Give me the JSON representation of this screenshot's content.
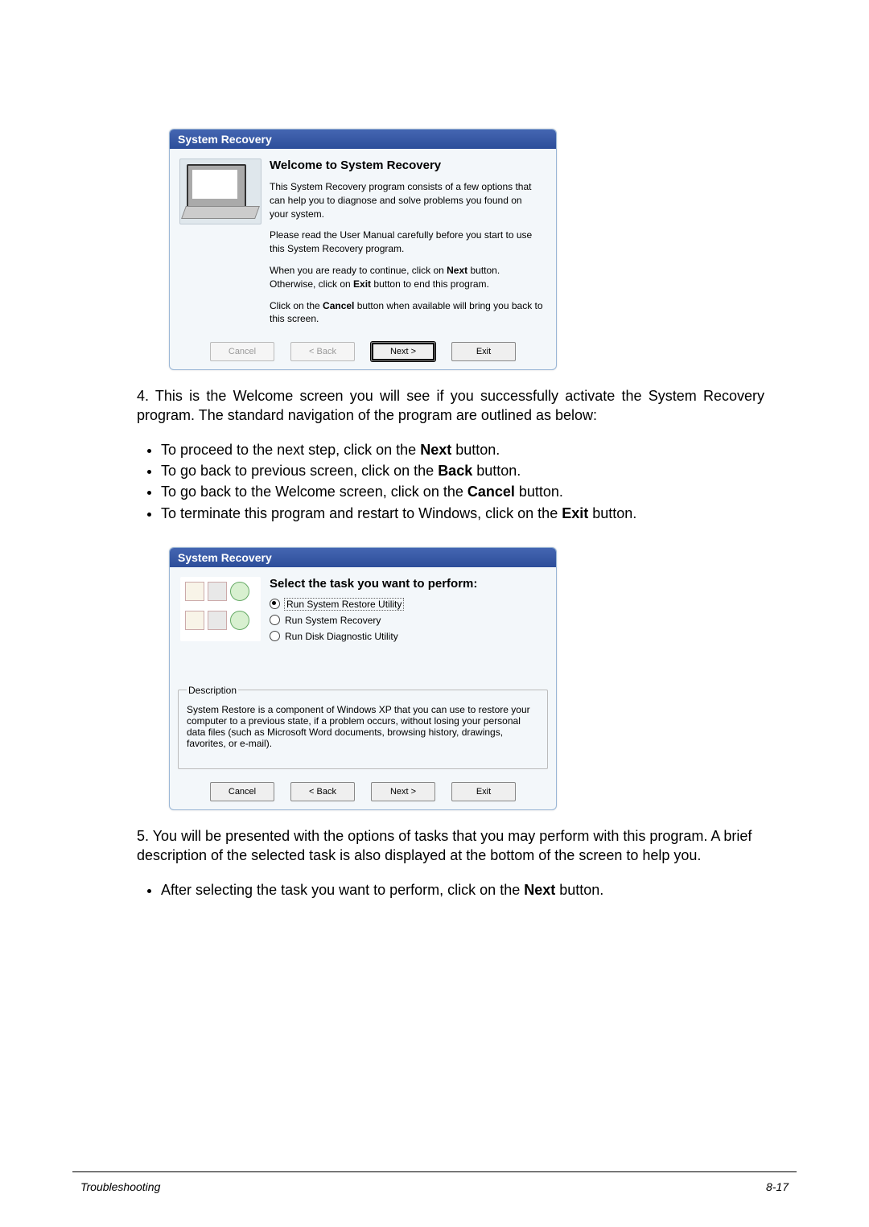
{
  "dialog1": {
    "title": "System Recovery",
    "heading": "Welcome to System Recovery",
    "p1": "This System Recovery program consists of a few options that can help you to diagnose and solve problems you found on your system.",
    "p2": "Please read the User Manual carefully before you start to use this System Recovery program.",
    "p3_a": "When you are ready to continue, click on ",
    "p3_b": "Next",
    "p3_c": " button. Otherwise, click on ",
    "p3_d": "Exit",
    "p3_e": " button to end this program.",
    "p4_a": "Click on the ",
    "p4_b": "Cancel",
    "p4_c": " button when available will bring you back to this screen.",
    "buttons": {
      "cancel": "Cancel",
      "back": "< Back",
      "next": "Next >",
      "exit": "Exit"
    }
  },
  "step4": {
    "lead": "4. This is the Welcome screen you will see if you successfully activate the System Recovery program.  The standard navigation of the program are outlined as below:",
    "b1_a": "To proceed to the next step, click on the ",
    "b1_b": "Next",
    "b1_c": " button.",
    "b2_a": "To go back to previous screen, click on the ",
    "b2_b": "Back",
    "b2_c": " button.",
    "b3_a": "To go back to the Welcome screen, click on the ",
    "b3_b": "Cancel",
    "b3_c": " button.",
    "b4_a": "To terminate this program and restart to Windows, click on the ",
    "b4_b": "Exit",
    "b4_c": " button."
  },
  "dialog2": {
    "title": "System Recovery",
    "heading": "Select the task you want to perform:",
    "opt1": "Run System Restore Utility",
    "opt2": "Run System Recovery",
    "opt3": "Run Disk Diagnostic Utility",
    "desc_legend": "Description",
    "desc_text": "System Restore is a component of Windows XP that you can use to restore your computer to a previous state, if a problem occurs, without losing your personal data files (such as Microsoft Word documents, browsing history, drawings, favorites, or e-mail).",
    "buttons": {
      "cancel": "Cancel",
      "back": "< Back",
      "next": "Next >",
      "exit": "Exit"
    }
  },
  "step5": {
    "lead": "5. You will be presented with the options of tasks that you may perform with this program. A brief description of the selected task is also displayed at the bottom of the screen to help you.",
    "b1_a": "After selecting the task you want to perform, click on the ",
    "b1_b": "Next",
    "b1_c": " button."
  },
  "footer": {
    "left": "Troubleshooting",
    "right": "8-17"
  }
}
